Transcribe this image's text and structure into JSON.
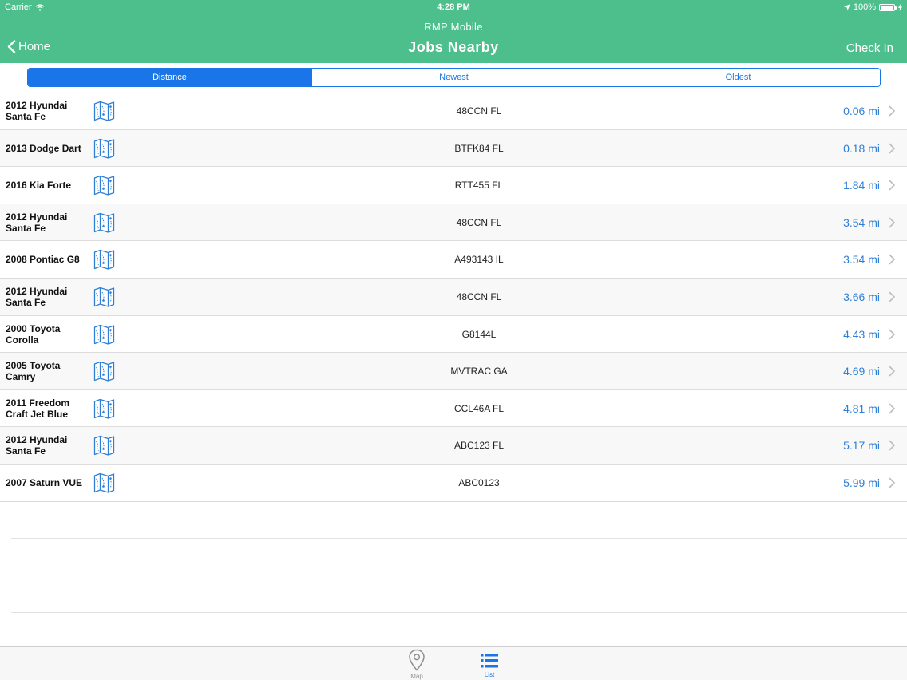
{
  "status_bar": {
    "carrier": "Carrier",
    "time": "4:28 PM",
    "battery": "100%"
  },
  "header": {
    "app_title": "RMP Mobile",
    "title": "Jobs Nearby",
    "back_label": "Home",
    "right_label": "Check In",
    "color": "#4dbf8c"
  },
  "segments": [
    {
      "label": "Distance",
      "active": true
    },
    {
      "label": "Newest",
      "active": false
    },
    {
      "label": "Oldest",
      "active": false
    }
  ],
  "accent_color": "#1a76e8",
  "jobs": [
    {
      "name": "2012 Hyundai Santa Fe",
      "plate": "48CCN FL",
      "distance": "0.06 mi"
    },
    {
      "name": "2013 Dodge Dart",
      "plate": "BTFK84 FL",
      "distance": "0.18 mi"
    },
    {
      "name": "2016 Kia Forte",
      "plate": "RTT455 FL",
      "distance": "1.84 mi"
    },
    {
      "name": "2012 Hyundai Santa Fe",
      "plate": "48CCN FL",
      "distance": "3.54 mi"
    },
    {
      "name": "2008 Pontiac G8",
      "plate": "A493143 IL",
      "distance": "3.54 mi"
    },
    {
      "name": "2012 Hyundai Santa Fe",
      "plate": "48CCN FL",
      "distance": "3.66 mi"
    },
    {
      "name": "2000 Toyota Corolla",
      "plate": "G8144L",
      "distance": "4.43 mi"
    },
    {
      "name": "2005 Toyota Camry",
      "plate": "MVTRAC GA",
      "distance": "4.69 mi"
    },
    {
      "name": "2011 Freedom Craft Jet Blue",
      "plate": "CCL46A FL",
      "distance": "4.81 mi"
    },
    {
      "name": "2012 Hyundai Santa Fe",
      "plate": "ABC123 FL",
      "distance": "5.17 mi"
    },
    {
      "name": "2007 Saturn VUE",
      "plate": "ABC0123",
      "distance": "5.99 mi"
    }
  ],
  "row_icons": {
    "map": "map-icon",
    "chevron": "chevron-right-icon"
  },
  "tabbar": {
    "tabs": [
      {
        "label": "Map",
        "icon": "map-pin-icon",
        "active": false
      },
      {
        "label": "List",
        "icon": "list-icon",
        "active": true
      }
    ]
  }
}
